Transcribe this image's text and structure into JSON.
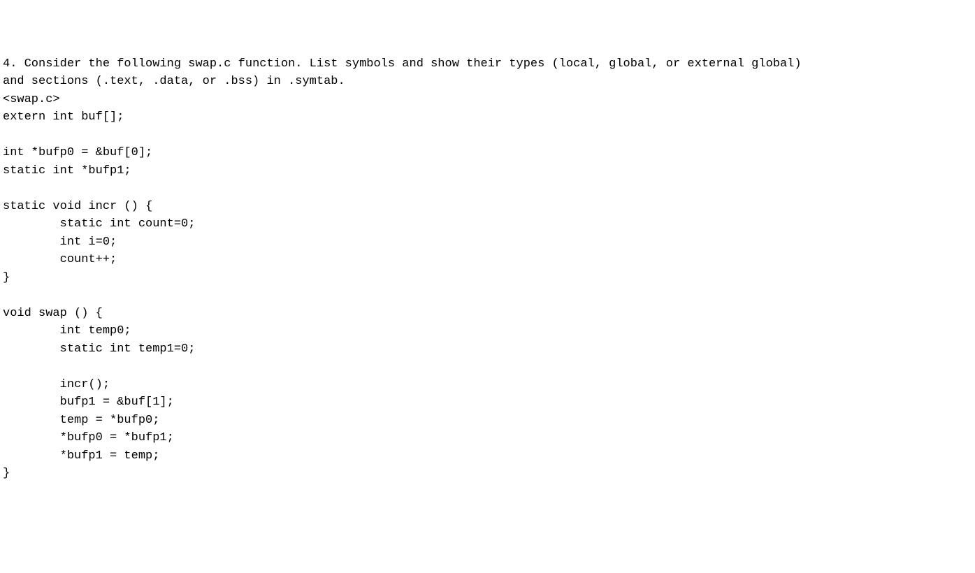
{
  "question": {
    "number": "4.",
    "prompt_line1": "Consider the following swap.c function. List symbols and show their types (local, global, or external global)",
    "prompt_line2": "and sections (.text, .data, or .bss) in .symtab."
  },
  "code": {
    "filename": "<swap.c>",
    "lines": [
      "extern int buf[];",
      "",
      "int *bufp0 = &buf[0];",
      "static int *bufp1;",
      "",
      "static void incr () {",
      "        static int count=0;",
      "        int i=0;",
      "        count++;",
      "}",
      "",
      "void swap () {",
      "        int temp0;",
      "        static int temp1=0;",
      "",
      "        incr();",
      "        bufp1 = &buf[1];",
      "        temp = *bufp0;",
      "        *bufp0 = *bufp1;",
      "        *bufp1 = temp;",
      "}"
    ]
  }
}
